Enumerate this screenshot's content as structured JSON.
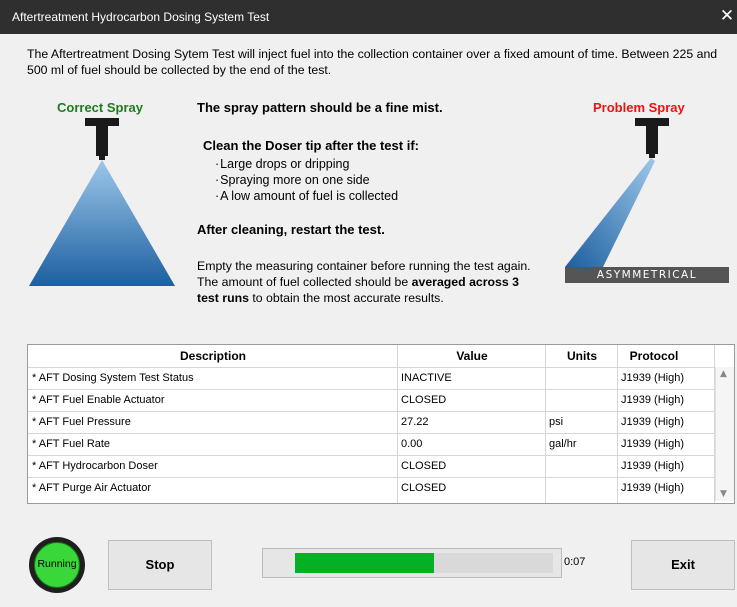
{
  "window": {
    "title": "Aftertreatment Hydrocarbon Dosing System Test",
    "close_glyph": "✕"
  },
  "intro": "The Aftertreatment Dosing Sytem Test will inject fuel into the collection container over a fixed amount of time. Between 225 and 500 ml of fuel should be collected by the end of the test.",
  "spray": {
    "correct_label": "Correct Spray",
    "correct_color": "#1f7a1f",
    "problem_label": "Problem Spray",
    "problem_color": "#ee1111",
    "problem_badge": "ASYMMETRICAL"
  },
  "guidance": {
    "heading1": "The spray pattern should be a fine mist.",
    "heading2": "Clean the Doser tip after the test if:",
    "items": [
      "Large drops or dripping",
      "Spraying more on one side",
      "A low amount of fuel is collected"
    ],
    "heading3": "After cleaning, restart the test.",
    "para_part1": "Empty the measuring container before running the test again. The amount of fuel collected should be ",
    "para_bold": "averaged across 3 test runs",
    "para_part2": " to obtain the most accurate results."
  },
  "table": {
    "columns": [
      "Description",
      "Value",
      "Units",
      "Protocol"
    ],
    "rows": [
      [
        "* AFT Dosing System Test Status",
        "INACTIVE",
        "",
        "J1939 (High)"
      ],
      [
        "* AFT Fuel Enable Actuator",
        "CLOSED",
        "",
        "J1939 (High)"
      ],
      [
        "* AFT Fuel Pressure",
        "27.22",
        "psi",
        "J1939 (High)"
      ],
      [
        "* AFT Fuel Rate",
        "0.00",
        "gal/hr",
        "J1939 (High)"
      ],
      [
        "* AFT Hydrocarbon Doser",
        "CLOSED",
        "",
        "J1939 (High)"
      ],
      [
        "* AFT Purge Air Actuator",
        "CLOSED",
        "",
        "J1939 (High)"
      ]
    ]
  },
  "status": {
    "label": "Running",
    "color": "#39d739"
  },
  "controls": {
    "stop_label": "Stop",
    "exit_label": "Exit",
    "progress_fraction": 0.54,
    "progress_color": "#06b025",
    "elapsed": "0:07"
  }
}
